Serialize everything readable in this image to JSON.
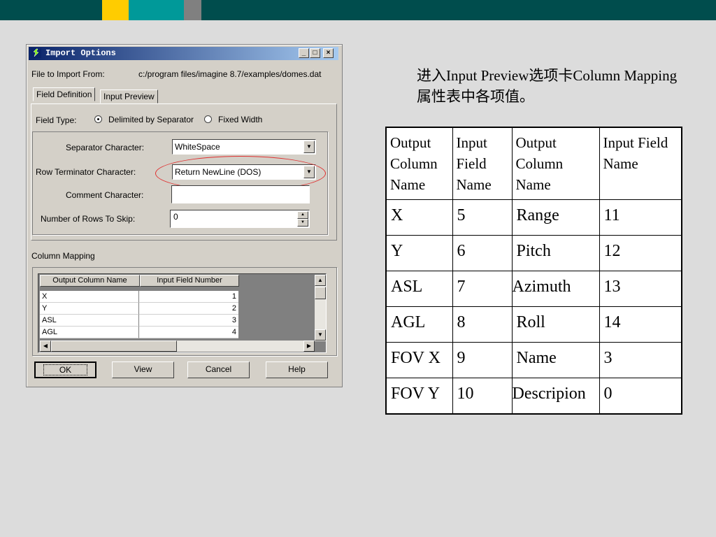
{
  "colors": {
    "top_bar": "#004d4d",
    "accent_yellow": "#ffcc00",
    "accent_teal": "#009999",
    "accent_gray": "#808080",
    "title_bar": "#0a246a",
    "highlight_oval": "#e03030"
  },
  "dialog": {
    "title": "Import Options",
    "file_label": "File to Import From:",
    "file_path": "c:/program files/imagine 8.7/examples/domes.dat",
    "tabs": [
      {
        "label": "Field Definition"
      },
      {
        "label": "Input Preview"
      }
    ],
    "field_type_label": "Field Type:",
    "field_type_options": [
      {
        "label": "Delimited by Separator",
        "selected": true
      },
      {
        "label": "Fixed Width",
        "selected": false
      }
    ],
    "separator_label": "Separator Character:",
    "separator_value": "WhiteSpace",
    "row_term_label": "Row Terminator Character:",
    "row_term_value": "Return NewLine (DOS)",
    "comment_label": "Comment Character:",
    "comment_value": "",
    "skip_label": "Number of Rows To Skip:",
    "skip_value": "0",
    "column_mapping_label": "Column Mapping",
    "grid_headers": [
      "Output Column Name",
      "Input Field Number"
    ],
    "grid_rows": [
      {
        "name": "X",
        "num": "1"
      },
      {
        "name": "Y",
        "num": "2"
      },
      {
        "name": "ASL",
        "num": "3"
      },
      {
        "name": "AGL",
        "num": "4"
      }
    ],
    "buttons": {
      "ok": "OK",
      "view": "View",
      "cancel": "Cancel",
      "help": "Help"
    }
  },
  "description": "进入Input Preview选项卡Column Mapping属性表中各项值。",
  "mapping_table": {
    "headers": [
      "Output Column Name",
      "Input Field Name",
      "Output Column Name",
      "Input Field Name"
    ],
    "rows": [
      [
        "X",
        "5",
        "Range",
        "11"
      ],
      [
        "Y",
        "6",
        "Pitch",
        "12"
      ],
      [
        "ASL",
        "7",
        "Azimuth",
        "13"
      ],
      [
        "AGL",
        "8",
        "Roll",
        "14"
      ],
      [
        "FOV X",
        "9",
        "Name",
        "3"
      ],
      [
        "FOV Y",
        "10",
        "Descripion",
        "0"
      ]
    ]
  }
}
